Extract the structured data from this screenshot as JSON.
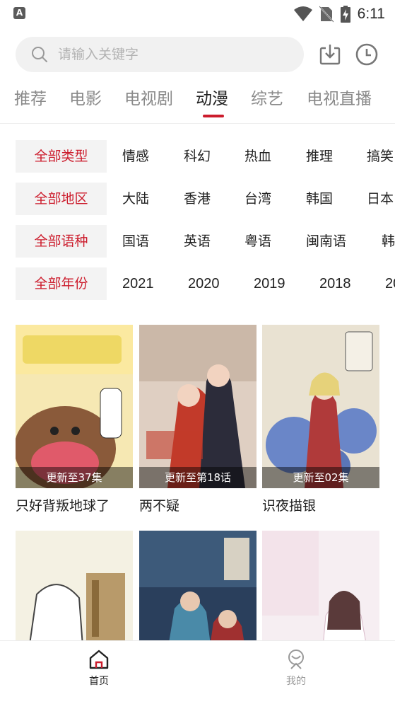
{
  "status_bar": {
    "notif_glyph": "A",
    "time": "6:11"
  },
  "search": {
    "placeholder": "请输入关键字",
    "value": ""
  },
  "toolbar": {
    "download_icon": "download-icon",
    "history_icon": "history-clock-icon"
  },
  "tabs": [
    "推荐",
    "电影",
    "电视剧",
    "动漫",
    "综艺",
    "电视直播"
  ],
  "active_tab": "动漫",
  "accent_color": "#cc1c2c",
  "filters": {
    "type": {
      "all": "全部类型",
      "options": [
        "情感",
        "科幻",
        "热血",
        "推理",
        "搞笑"
      ]
    },
    "region": {
      "all": "全部地区",
      "options": [
        "大陆",
        "香港",
        "台湾",
        "韩国",
        "日本"
      ]
    },
    "lang": {
      "all": "全部语种",
      "options": [
        "国语",
        "英语",
        "粤语",
        "闽南语",
        "韩"
      ]
    },
    "year": {
      "all": "全部年份",
      "options": [
        "2021",
        "2020",
        "2019",
        "2018",
        "20"
      ]
    }
  },
  "items": [
    {
      "title": "只好背叛地球了",
      "badge": "更新至37集"
    },
    {
      "title": "两不疑",
      "badge": "更新至第18话"
    },
    {
      "title": "识夜描银",
      "badge": "更新至02集"
    },
    {
      "title": "",
      "badge": ""
    },
    {
      "title": "",
      "badge": ""
    },
    {
      "title": "",
      "badge": ""
    }
  ],
  "bottom_nav": {
    "home": "首页",
    "mine": "我的"
  }
}
